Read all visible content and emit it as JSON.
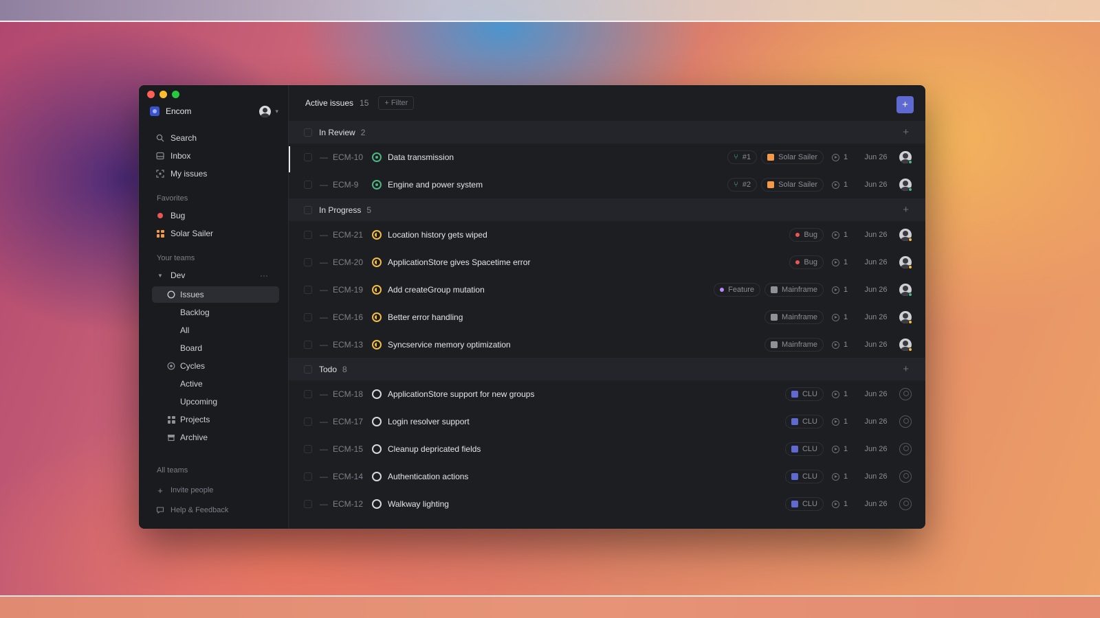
{
  "colors": {
    "accent": "#5e6ad2",
    "in_review": "#4cb782",
    "in_progress": "#f2be42",
    "bug": "#eb5757",
    "feature": "#bb87fc",
    "solar_sailer": "#f2994a",
    "mainframe": "#8f9198",
    "clu": "#5e6ad2"
  },
  "sidebar": {
    "workspace": "Encom",
    "nav": [
      {
        "label": "Search",
        "icon": "search-icon"
      },
      {
        "label": "Inbox",
        "icon": "inbox-icon"
      },
      {
        "label": "My issues",
        "icon": "my-issues-icon"
      }
    ],
    "favorites_label": "Favorites",
    "favorites": [
      {
        "label": "Bug",
        "icon": "bug-label-dot"
      },
      {
        "label": "Solar Sailer",
        "icon": "project-grid-icon"
      }
    ],
    "your_teams_label": "Your teams",
    "team": "Dev",
    "team_items": {
      "issues": "Issues",
      "backlog": "Backlog",
      "all": "All",
      "board": "Board",
      "cycles": "Cycles",
      "active": "Active",
      "upcoming": "Upcoming",
      "projects": "Projects",
      "archive": "Archive"
    },
    "all_teams": "All teams",
    "invite": "Invite people",
    "help": "Help & Feedback"
  },
  "header": {
    "title": "Active issues",
    "count": "15",
    "filter": "+ Filter"
  },
  "groups": [
    {
      "name": "In Review",
      "count": "2",
      "status": "review",
      "issues": [
        {
          "id": "ECM-10",
          "title": "Data transmission",
          "pr": "#1",
          "project": "Solar Sailer",
          "estimate": "1",
          "date": "Jun 26",
          "assignee": "person",
          "presence": "#4cb782"
        },
        {
          "id": "ECM-9",
          "title": "Engine and power system",
          "pr": "#2",
          "project": "Solar Sailer",
          "estimate": "1",
          "date": "Jun 26",
          "assignee": "person",
          "presence": "#4cb782"
        }
      ]
    },
    {
      "name": "In Progress",
      "count": "5",
      "status": "progress",
      "issues": [
        {
          "id": "ECM-21",
          "title": "Location history gets wiped",
          "label": "Bug",
          "estimate": "1",
          "date": "Jun 26",
          "assignee": "person",
          "presence": "#f2be42"
        },
        {
          "id": "ECM-20",
          "title": "ApplicationStore gives Spacetime error",
          "label": "Bug",
          "estimate": "1",
          "date": "Jun 26",
          "assignee": "person",
          "presence": "#f2be42"
        },
        {
          "id": "ECM-19",
          "title": "Add createGroup mutation",
          "label": "Feature",
          "project": "Mainframe",
          "estimate": "1",
          "date": "Jun 26",
          "assignee": "person",
          "presence": "#4cb782"
        },
        {
          "id": "ECM-16",
          "title": "Better error handling",
          "project": "Mainframe",
          "estimate": "1",
          "date": "Jun 26",
          "assignee": "person",
          "presence": "#f2be42"
        },
        {
          "id": "ECM-13",
          "title": "Syncservice memory optimization",
          "project": "Mainframe",
          "estimate": "1",
          "date": "Jun 26",
          "assignee": "person",
          "presence": "#f2be42"
        }
      ]
    },
    {
      "name": "Todo",
      "count": "8",
      "status": "todo",
      "issues": [
        {
          "id": "ECM-18",
          "title": "ApplicationStore support for new groups",
          "project": "CLU",
          "estimate": "1",
          "date": "Jun 26",
          "assignee": "empty"
        },
        {
          "id": "ECM-17",
          "title": "Login resolver support",
          "project": "CLU",
          "estimate": "1",
          "date": "Jun 26",
          "assignee": "empty"
        },
        {
          "id": "ECM-15",
          "title": "Cleanup depricated fields",
          "project": "CLU",
          "estimate": "1",
          "date": "Jun 26",
          "assignee": "empty"
        },
        {
          "id": "ECM-14",
          "title": "Authentication actions",
          "project": "CLU",
          "estimate": "1",
          "date": "Jun 26",
          "assignee": "empty"
        },
        {
          "id": "ECM-12",
          "title": "Walkway lighting",
          "project": "CLU",
          "estimate": "1",
          "date": "Jun 26",
          "assignee": "empty"
        }
      ]
    }
  ]
}
